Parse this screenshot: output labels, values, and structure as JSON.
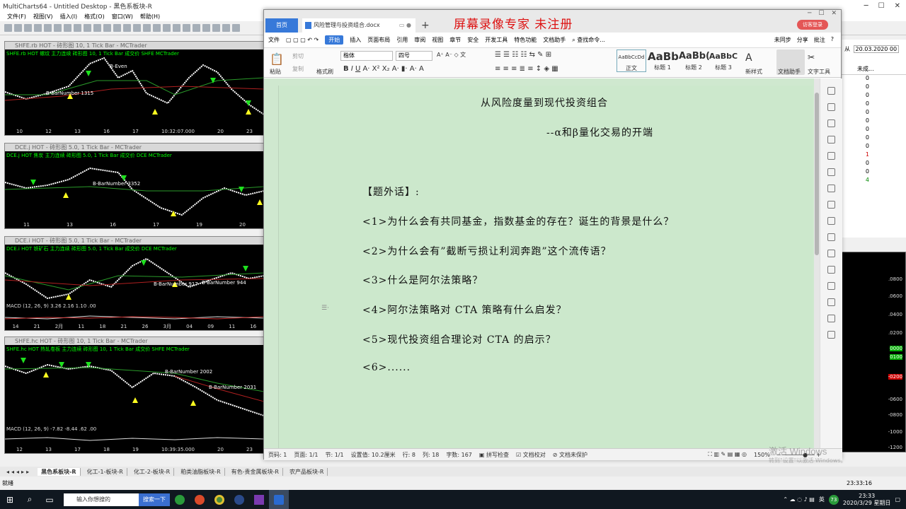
{
  "mc": {
    "title": "MultiCharts64 - Untitled Desktop - 黑色系板块-R",
    "menu": [
      "文件(F)",
      "视图(V)",
      "插入(I)",
      "格式(O)",
      "窗口(W)",
      "帮助(H)"
    ],
    "charts": [
      {
        "header": "SHFE.rb HOT - 砖形图 10, 1 Tick Bar - MCTrader",
        "label": "SHFE.rb HOT  螺纹 主力连续  砖形图 10, 1 Tick Bar   成交价  SHFE  MCTrader",
        "annot": [
          "B-BarNumber 1315",
          "B-Even"
        ],
        "axis": [
          "10",
          "12",
          "13",
          "16",
          "17",
          "10:32:07.000",
          "20",
          "23"
        ]
      },
      {
        "header": "DCE.j HOT - 砖形图 5.0, 1 Tick Bar - MCTrader",
        "label": "DCE.j HOT  焦炭 主力连续  砖形图 5.0, 1 Tick Bar   成交价  DCE  MCTrader",
        "annot": [
          "B-BarNumber 3352"
        ],
        "axis": [
          "11",
          "13",
          "16",
          "17",
          "19",
          "20"
        ]
      },
      {
        "header": "DCE.i HOT - 砖形图 5.0, 1 Tick Bar - MCTrader",
        "label": "DCE.i HOT  铁矿石 主力连续  砖形图 5.0, 1 Tick Bar   成交价  DCE  MCTrader",
        "annot": [
          "B-BarNumber 917",
          "B-BarNumber 944"
        ],
        "macd": "MACD   (12, 26, 9)  3.26  2.16  1.10  .00",
        "axis": [
          "14",
          "21",
          "2月",
          "11",
          "18",
          "21",
          "26",
          "3月",
          "04",
          "09",
          "11",
          "16"
        ]
      },
      {
        "header": "SHFE.hc HOT - 砖形图 10, 1 Tick Bar - MCTrader",
        "label": "SHFE.hc HOT  热轧卷板 主力连续  砖形图 10, 1 Tick Bar   成交价  SHFE  MCTrader",
        "annot": [
          "B-BarNumber 2002",
          "B-BarNumber 2031"
        ],
        "macd": "MACD   (12, 26, 9)  -7.82  -8.44  .62  .00",
        "axis": [
          "12",
          "13",
          "17",
          "18",
          "19",
          "10:39:35.000",
          "20",
          "23"
        ]
      }
    ],
    "right_panel": {
      "date_label": "从",
      "date": "20.03.2020 00",
      "col": "未成...",
      "values": [
        "0",
        "0",
        "0",
        "0",
        "0",
        "0",
        "0",
        "0",
        "0",
        "1",
        "0",
        "0",
        "4"
      ]
    },
    "right_prices": [
      ".0800",
      ".0600",
      ".0400",
      ".0200",
      "0000",
      "0100",
      "-0200",
      "-0600",
      "-0800",
      "-1000",
      "-1200"
    ],
    "sheet_tabs": [
      "黑色系板块-R",
      "化工-1-板块-R",
      "化工-2-板块-R",
      "粕类油脂板块-R",
      "有色-贵金属板块-R",
      "农产品板块-R"
    ],
    "status": "就绪",
    "status_time": "23:33:16"
  },
  "taskbar": {
    "search_placeholder": "输入你想搜的",
    "search_button": "搜索一下",
    "ime": "英",
    "badge": "73",
    "time": "23:33",
    "date": "2020/3/29 星期日"
  },
  "wps": {
    "tab_home": "首页",
    "tab_doc": "风险管理与投资组合.docx",
    "watermark": "屏幕录像专家  未注册",
    "login": "访客登录",
    "menu": [
      "文件",
      "开始",
      "插入",
      "页面布局",
      "引用",
      "审阅",
      "视图",
      "章节",
      "安全",
      "开发工具",
      "特色功能",
      "文档助手"
    ],
    "menu_search": "查找命令...",
    "menu_right": [
      "未同步",
      "分享",
      "批注"
    ],
    "font_name": "楷体",
    "font_size": "四号",
    "ribbon_labels": {
      "paste": "粘贴",
      "cut": "剪切",
      "copy": "复制",
      "format_painter": "格式刷",
      "new_style": "新样式",
      "doc_assist": "文档助手",
      "text_tools": "文字工具"
    },
    "styles": [
      {
        "preview": "AaBbCcDd",
        "name": "正文"
      },
      {
        "preview": "AaBb",
        "name": "标题 1"
      },
      {
        "preview": "AaBb(",
        "name": "标题 2"
      },
      {
        "preview": "AaBbC",
        "name": "标题 3"
      }
    ],
    "doc": {
      "title": "从风险度量到现代投资组合",
      "subtitle": "--α和β量化交易的开端",
      "heading": "【题外话】:",
      "items": [
        "<1>为什么会有共同基金，指数基金的存在？诞生的背景是什么？",
        "<2>为什么会有”截断亏损让利润奔跑”这个流传语？",
        "<3>什么是阿尔法策略？",
        "<4>阿尔法策略对 CTA 策略有什么启发？",
        "<5>现代投资组合理论对 CTA 的启示？",
        "<6>......"
      ]
    },
    "status": {
      "page_no": "页码: 1",
      "pages": "页面: 1/1",
      "section": "节: 1/1",
      "setting": "设置值: 10.2厘米",
      "row": "行: 8",
      "col": "列: 18",
      "chars": "字数: 167",
      "spell": "拼写检查",
      "proof": "文档校对",
      "protect": "文档未保护",
      "zoom": "150%"
    }
  },
  "overlay": {
    "activate": "激活 Windows",
    "activate_hint": "转到\"设置\"以激活 Windows。"
  }
}
